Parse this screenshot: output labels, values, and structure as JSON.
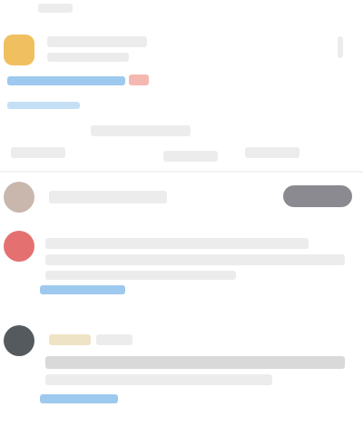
{
  "feed": {
    "header": {
      "label": "",
      "title": "",
      "subtitle": "",
      "link": "",
      "badge": "",
      "menu_icon": "more-vertical-icon",
      "avatar_color": "#f0c060"
    },
    "toolbar": {
      "heading": "",
      "tabs": [
        "",
        "",
        ""
      ],
      "separator_color": "#f2f2f2"
    },
    "suggestion": {
      "name": "",
      "button_label": "",
      "avatar_color": "#c9b7ad",
      "button_color": "#8a8a90"
    },
    "posts": [
      {
        "author": "",
        "text_lines": [
          "",
          ""
        ],
        "link": "",
        "avatar_color": "#e57070"
      },
      {
        "author": "",
        "tag": "",
        "text_lines": [
          "",
          ""
        ],
        "link": "",
        "avatar_color": "#555a5f"
      }
    ]
  }
}
